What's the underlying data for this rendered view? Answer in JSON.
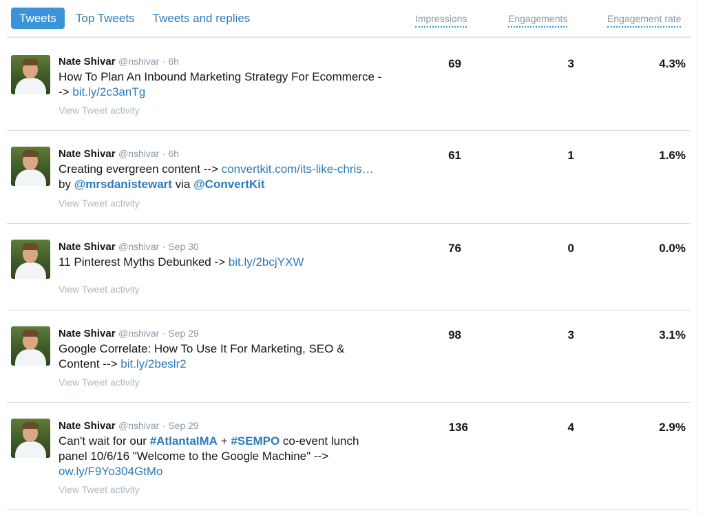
{
  "tabs": [
    "Tweets",
    "Top Tweets",
    "Tweets and replies"
  ],
  "columns": {
    "impressions": "Impressions",
    "engagements": "Engagements",
    "engagement_rate": "Engagement rate"
  },
  "author": {
    "name": "Nate Shivar",
    "handle": "@nshivar"
  },
  "activity_label": "View Tweet activity",
  "tweets": [
    {
      "time": "· 6h",
      "text_1": "How To Plan An Inbound Marketing Strategy For Ecommerce --> ",
      "link_1": "bit.ly/2c3anTg",
      "impressions": "69",
      "engagements": "3",
      "rate": "4.3%"
    },
    {
      "time": "· 6h",
      "text_1": "Creating evergreen content --> ",
      "link_1": "convertkit.com/its-like-chris…",
      "text_2": " by ",
      "mention_1": "@mrsdanistewart",
      "text_3": " via ",
      "mention_2": "@ConvertKit",
      "impressions": "61",
      "engagements": "1",
      "rate": "1.6%"
    },
    {
      "time": "· Sep 30",
      "text_1": "11 Pinterest Myths Debunked -> ",
      "link_1": "bit.ly/2bcjYXW",
      "impressions": "76",
      "engagements": "0",
      "rate": "0.0%"
    },
    {
      "time": "· Sep 29",
      "text_1": "Google Correlate: How To Use It For Marketing, SEO & Content --> ",
      "link_1": "bit.ly/2beslr2",
      "impressions": "98",
      "engagements": "3",
      "rate": "3.1%"
    },
    {
      "time": "· Sep 29",
      "text_1": "Can't wait for our ",
      "hashtag_1": "#AtlantaIMA",
      "text_2": " + ",
      "hashtag_2": "#SEMPO",
      "text_3": " co-event lunch panel 10/6/16 \"Welcome to the Google Machine\" --> ",
      "link_1": "ow.ly/F9Yo304GtMo",
      "impressions": "136",
      "engagements": "4",
      "rate": "2.9%"
    }
  ]
}
